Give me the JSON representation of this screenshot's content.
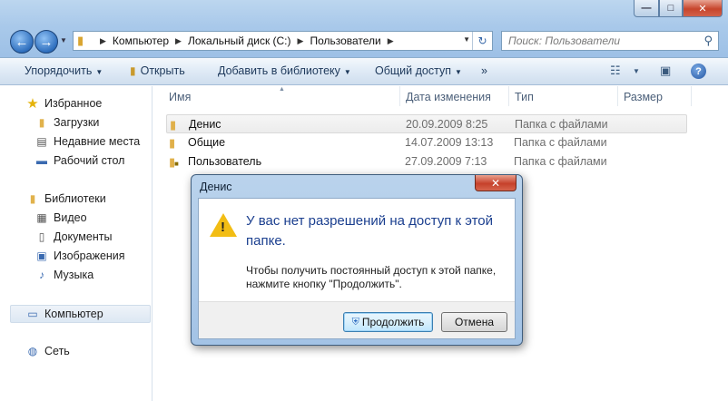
{
  "window": {
    "controls": {
      "minimize": "—",
      "maximize": "□",
      "close": "✕"
    }
  },
  "navigation": {
    "back": "←",
    "forward": "→",
    "history_dropdown": "▼"
  },
  "address": {
    "crumbs": [
      "Компьютер",
      "Локальный диск (C:)",
      "Пользователи"
    ],
    "separator": "▶",
    "dropdown": "▼",
    "refresh": "↻"
  },
  "search": {
    "placeholder": "Поиск: Пользователи",
    "icon": "⚲"
  },
  "toolbar": {
    "organize": "Упорядочить",
    "open": "Открыть",
    "add_to_library": "Добавить в библиотеку",
    "share": "Общий доступ",
    "more": "»",
    "caret": "▼",
    "view_icon": "☷",
    "preview_icon": "▣",
    "help": "?"
  },
  "sidebar": {
    "favorites": {
      "label": "Избранное",
      "items": [
        "Загрузки",
        "Недавние места",
        "Рабочий стол"
      ]
    },
    "libraries": {
      "label": "Библиотеки",
      "items": [
        "Видео",
        "Документы",
        "Изображения",
        "Музыка"
      ]
    },
    "computer": "Компьютер",
    "network": "Сеть"
  },
  "file_list": {
    "columns": {
      "name": "Имя",
      "date": "Дата изменения",
      "type": "Тип",
      "size": "Размер"
    },
    "rows": [
      {
        "name": "Денис",
        "date": "20.09.2009 8:25",
        "type": "Папка с файлами"
      },
      {
        "name": "Общие",
        "date": "14.07.2009 13:13",
        "type": "Папка с файлами"
      },
      {
        "name": "Пользователь",
        "date": "27.09.2009 7:13",
        "type": "Папка с файлами"
      }
    ]
  },
  "dialog": {
    "title": "Денис",
    "close": "✕",
    "heading": "У вас нет разрешений на доступ к этой папке.",
    "message": "Чтобы получить постоянный доступ к этой папке, нажмите кнопку \"Продолжить\".",
    "continue_button": "Продолжить",
    "cancel_button": "Отмена"
  },
  "colors": {
    "dialog_heading": "#1b3f8f",
    "titlebar": "#a9c9ea",
    "close_button": "#c6412b"
  }
}
